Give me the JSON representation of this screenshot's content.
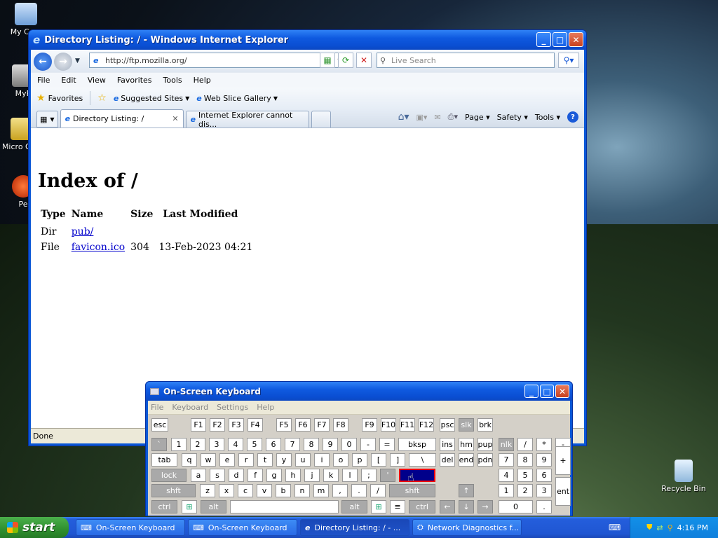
{
  "desktop": {
    "icons": [
      {
        "label": "My Com"
      },
      {
        "label": "MyP"
      },
      {
        "label": "Micro Outl"
      },
      {
        "label": "Pe"
      },
      {
        "label": "Recycle Bin"
      }
    ]
  },
  "ie": {
    "title": "Directory Listing: / - Windows Internet Explorer",
    "address": "http://ftp.mozilla.org/",
    "search_placeholder": "Live Search",
    "menu": [
      "File",
      "Edit",
      "View",
      "Favorites",
      "Tools",
      "Help"
    ],
    "favorites_label": "Favorites",
    "suggested_sites": "Suggested Sites",
    "web_slice": "Web Slice Gallery",
    "tabs": [
      {
        "label": "Directory Listing: /"
      },
      {
        "label": "Internet Explorer cannot dis..."
      }
    ],
    "commands": {
      "page": "Page",
      "safety": "Safety",
      "tools": "Tools"
    },
    "status": "Done"
  },
  "listing": {
    "heading": "Index of /",
    "columns": [
      "Type",
      "Name",
      "Size",
      "Last Modified"
    ],
    "rows": [
      {
        "type": "Dir",
        "name": "pub/",
        "size": "",
        "modified": ""
      },
      {
        "type": "File",
        "name": "favicon.ico",
        "size": "304",
        "modified": "13-Feb-2023 04:21"
      }
    ]
  },
  "osk": {
    "title": "On-Screen Keyboard",
    "menu": [
      "File",
      "Keyboard",
      "Settings",
      "Help"
    ]
  },
  "taskbar": {
    "start": "start",
    "tasks": [
      {
        "label": "On-Screen Keyboard"
      },
      {
        "label": "On-Screen Keyboard"
      },
      {
        "label": "Directory Listing: / - ..."
      },
      {
        "label": "Network Diagnostics f..."
      }
    ],
    "clock": "4:16 PM"
  },
  "colors": {
    "accent": "#0a57d6",
    "taskbar": "#245edc",
    "start": "#2f8f2f",
    "selected_key": "#00008b"
  }
}
